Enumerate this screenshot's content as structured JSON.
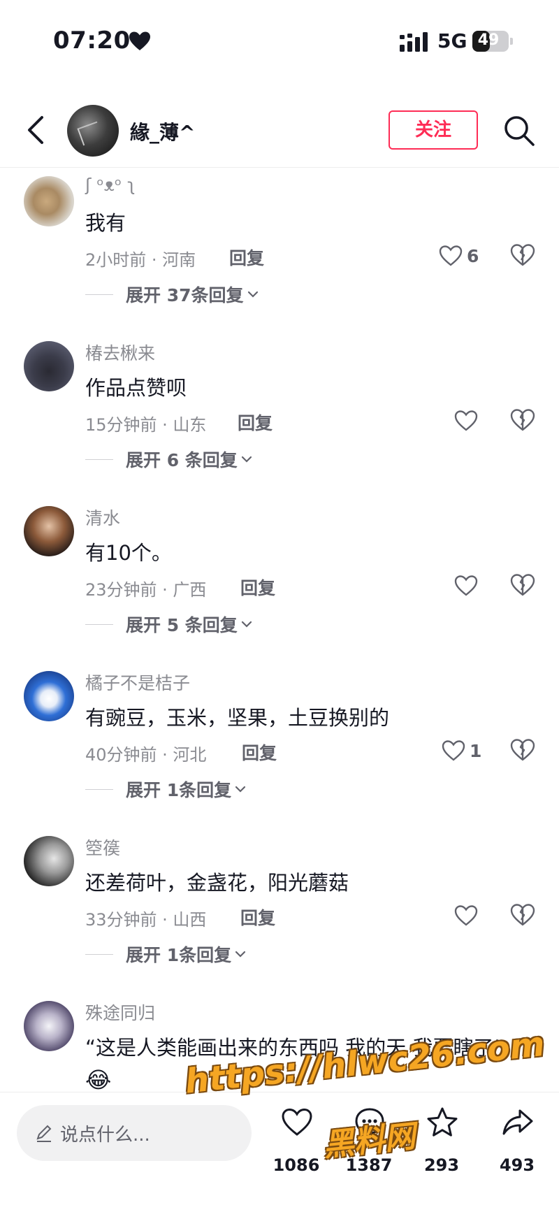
{
  "status_bar": {
    "time": "07:20",
    "network": "5G",
    "battery": "49",
    "battery_fraction": 0.49
  },
  "header": {
    "username": "緣_薄^",
    "follow_label": "关注"
  },
  "comments": [
    {
      "user": "ʃ ᵒᴥᵒ ʅ",
      "text": "我有",
      "meta": "2小时前 · 河南",
      "reply": "回复",
      "likes": "6",
      "expand": "展开 37条回复"
    },
    {
      "user": "椿去楸来",
      "text": "作品点赞呗",
      "meta": "15分钟前 · 山东",
      "reply": "回复",
      "likes": "",
      "expand": "展开 6 条回复"
    },
    {
      "user": "清水",
      "text": "有10个。",
      "meta": "23分钟前 · 广西",
      "reply": "回复",
      "likes": "",
      "expand": "展开 5 条回复"
    },
    {
      "user": "橘子不是桔子",
      "text": "有豌豆，玉米，坚果，土豆换别的",
      "meta": "40分钟前 · 河北",
      "reply": "回复",
      "likes": "1",
      "expand": "展开 1条回复"
    },
    {
      "user": "箜篌",
      "text": "还差荷叶，金盏花，阳光蘑菇",
      "meta": "33分钟前 · 山西",
      "reply": "回复",
      "likes": "",
      "expand": "展开 1条回复"
    },
    {
      "user": "殊途同归",
      "text": "“这是人类能画出来的东西吗 我的天 我要瞎了”",
      "emoji": "😂"
    }
  ],
  "bottom_bar": {
    "placeholder": "说点什么...",
    "like_count": "1086",
    "comment_count": "1387",
    "favorite_count": "293",
    "share_count": "493"
  },
  "watermark": {
    "url": "https://hlwc26.com",
    "text": "黑料网"
  },
  "colors": {
    "accent": "#fe2c55",
    "secondary_text": "#8a8b91",
    "watermark": "#f5a623"
  },
  "icons": [
    "heart-icon",
    "signal-icon",
    "battery-icon",
    "back-icon",
    "search-icon",
    "like-icon",
    "dislike-icon",
    "chevron-down-icon",
    "pencil-icon",
    "comment-icon",
    "star-icon",
    "share-icon"
  ]
}
